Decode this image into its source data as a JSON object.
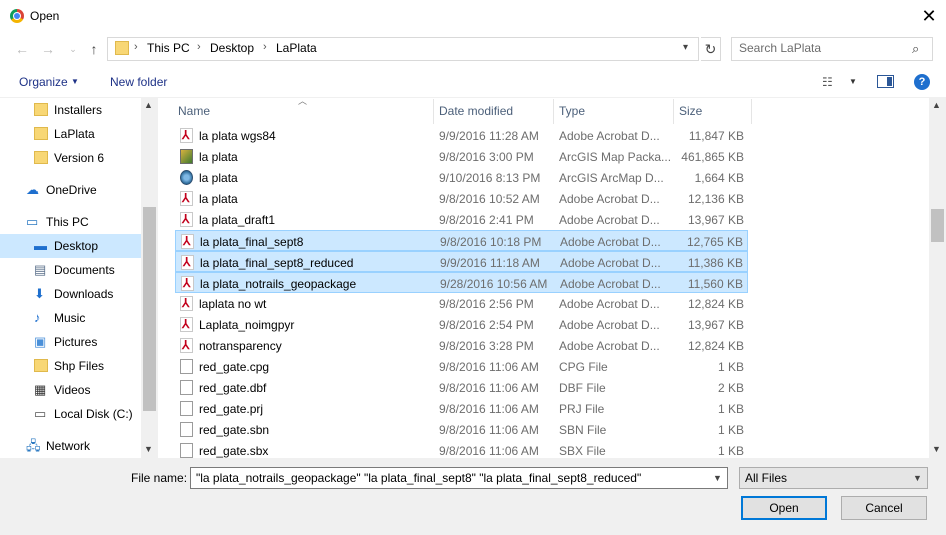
{
  "window": {
    "title": "Open",
    "close_symbol": "✕"
  },
  "address": {
    "crumbs": [
      "This PC",
      "Desktop",
      "LaPlata"
    ],
    "search_placeholder": "Search LaPlata"
  },
  "toolbar": {
    "organize": "Organize",
    "new_folder": "New folder",
    "help": "?"
  },
  "nav": {
    "items": [
      {
        "label": "Installers",
        "icon": "folder-icon"
      },
      {
        "label": "LaPlata",
        "icon": "folder-icon"
      },
      {
        "label": "Version 6",
        "icon": "folder-icon"
      },
      {
        "label": "OneDrive",
        "icon": "cloud-icon"
      },
      {
        "label": "This PC",
        "icon": "computer-icon"
      },
      {
        "label": "Desktop",
        "icon": "desktop-icon",
        "selected": true
      },
      {
        "label": "Documents",
        "icon": "documents-icon"
      },
      {
        "label": "Downloads",
        "icon": "downloads-icon"
      },
      {
        "label": "Music",
        "icon": "music-icon"
      },
      {
        "label": "Pictures",
        "icon": "pictures-icon"
      },
      {
        "label": "Shp Files",
        "icon": "folder-icon"
      },
      {
        "label": "Videos",
        "icon": "videos-icon"
      },
      {
        "label": "Local Disk (C:)",
        "icon": "disk-icon"
      },
      {
        "label": "Network",
        "icon": "network-icon"
      }
    ]
  },
  "columns": {
    "name": "Name",
    "date": "Date modified",
    "type": "Type",
    "size": "Size"
  },
  "files": [
    {
      "name": "la plata wgs84",
      "date": "9/9/2016 11:28 AM",
      "type": "Adobe Acrobat D...",
      "size": "11,847 KB",
      "icon": "pdf"
    },
    {
      "name": "la plata",
      "date": "9/8/2016 3:00 PM",
      "type": "ArcGIS Map Packa...",
      "size": "461,865 KB",
      "icon": "mpk"
    },
    {
      "name": "la plata",
      "date": "9/10/2016 8:13 PM",
      "type": "ArcGIS ArcMap D...",
      "size": "1,664 KB",
      "icon": "mxd"
    },
    {
      "name": "la plata",
      "date": "9/8/2016 10:52 AM",
      "type": "Adobe Acrobat D...",
      "size": "12,136 KB",
      "icon": "pdf"
    },
    {
      "name": "la plata_draft1",
      "date": "9/8/2016 2:41 PM",
      "type": "Adobe Acrobat D...",
      "size": "13,967 KB",
      "icon": "pdf"
    },
    {
      "name": "la plata_final_sept8",
      "date": "9/8/2016 10:18 PM",
      "type": "Adobe Acrobat D...",
      "size": "12,765 KB",
      "icon": "pdf",
      "selected": true
    },
    {
      "name": "la plata_final_sept8_reduced",
      "date": "9/9/2016 11:18 AM",
      "type": "Adobe Acrobat D...",
      "size": "11,386 KB",
      "icon": "pdf",
      "selected": true
    },
    {
      "name": "la plata_notrails_geopackage",
      "date": "9/28/2016 10:56 AM",
      "type": "Adobe Acrobat D...",
      "size": "11,560 KB",
      "icon": "pdf",
      "selected": true
    },
    {
      "name": "laplata no wt",
      "date": "9/8/2016 2:56 PM",
      "type": "Adobe Acrobat D...",
      "size": "12,824 KB",
      "icon": "pdf"
    },
    {
      "name": "Laplata_noimgpyr",
      "date": "9/8/2016 2:54 PM",
      "type": "Adobe Acrobat D...",
      "size": "13,967 KB",
      "icon": "pdf"
    },
    {
      "name": "notransparency",
      "date": "9/8/2016 3:28 PM",
      "type": "Adobe Acrobat D...",
      "size": "12,824 KB",
      "icon": "pdf"
    },
    {
      "name": "red_gate.cpg",
      "date": "9/8/2016 11:06 AM",
      "type": "CPG File",
      "size": "1 KB",
      "icon": "blank"
    },
    {
      "name": "red_gate.dbf",
      "date": "9/8/2016 11:06 AM",
      "type": "DBF File",
      "size": "2 KB",
      "icon": "blank"
    },
    {
      "name": "red_gate.prj",
      "date": "9/8/2016 11:06 AM",
      "type": "PRJ File",
      "size": "1 KB",
      "icon": "blank"
    },
    {
      "name": "red_gate.sbn",
      "date": "9/8/2016 11:06 AM",
      "type": "SBN File",
      "size": "1 KB",
      "icon": "blank"
    },
    {
      "name": "red_gate.sbx",
      "date": "9/8/2016 11:06 AM",
      "type": "SBX File",
      "size": "1 KB",
      "icon": "blank"
    }
  ],
  "bottom": {
    "file_name_label": "File name:",
    "file_name_value": "\"la plata_notrails_geopackage\" \"la plata_final_sept8\" \"la plata_final_sept8_reduced\"",
    "filter": "All Files",
    "open": "Open",
    "cancel": "Cancel"
  }
}
